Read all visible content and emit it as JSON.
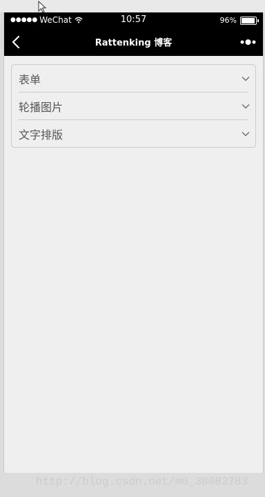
{
  "status_bar": {
    "signal": "●●●●●",
    "carrier": "WeChat",
    "time": "10:57",
    "battery_percent": "96%",
    "battery_level": 0.96
  },
  "nav_bar": {
    "title": "Rattenking 博客",
    "back_icon": "chevron-left-icon",
    "more_icon": "more-dots-icon"
  },
  "menu": {
    "items": [
      {
        "label": "表单"
      },
      {
        "label": "轮播图片"
      },
      {
        "label": "文字排版"
      }
    ],
    "chevron_icon": "chevron-down-icon"
  },
  "watermark": "http://blog.csdn.net/m0_38082783",
  "colors": {
    "nav_background": "#000000",
    "page_background": "#efefef",
    "border": "#c9c9c9",
    "label_text": "#555555"
  }
}
